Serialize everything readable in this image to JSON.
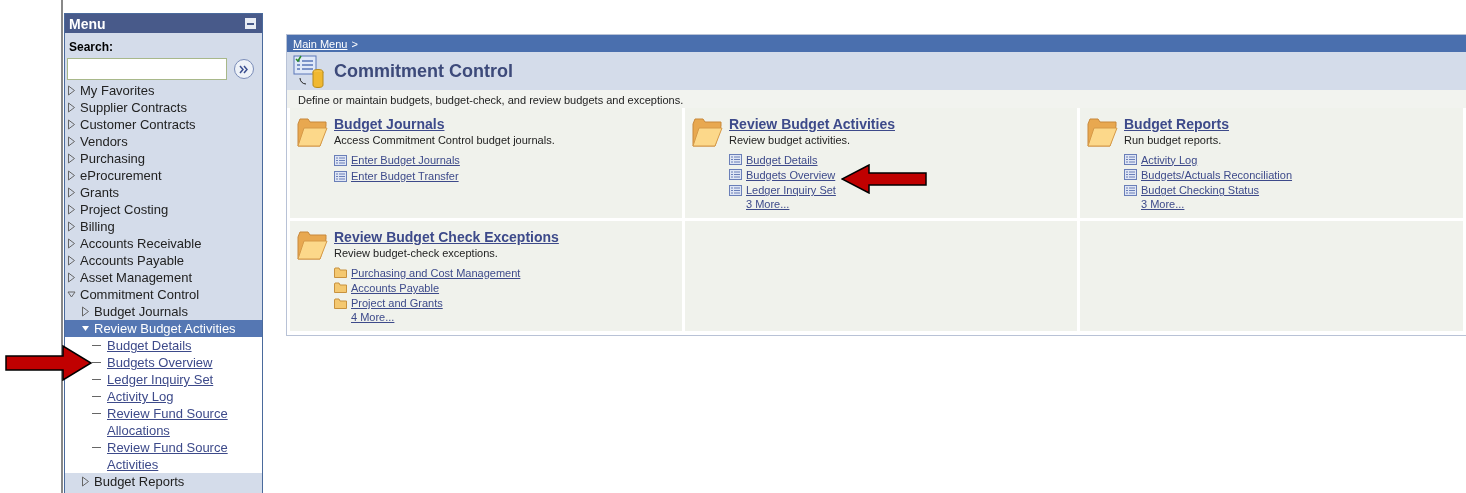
{
  "menu": {
    "title": "Menu",
    "search": {
      "label": "Search:"
    },
    "items": [
      {
        "label": "My Favorites",
        "kind": "folder",
        "expanded": false,
        "selected": false
      },
      {
        "label": "Supplier Contracts",
        "kind": "folder",
        "expanded": false,
        "selected": false
      },
      {
        "label": "Customer Contracts",
        "kind": "folder",
        "expanded": false,
        "selected": false
      },
      {
        "label": "Vendors",
        "kind": "folder",
        "expanded": false,
        "selected": false
      },
      {
        "label": "Purchasing",
        "kind": "folder",
        "expanded": false,
        "selected": false
      },
      {
        "label": "eProcurement",
        "kind": "folder",
        "expanded": false,
        "selected": false
      },
      {
        "label": "Grants",
        "kind": "folder",
        "expanded": false,
        "selected": false
      },
      {
        "label": "Project Costing",
        "kind": "folder",
        "expanded": false,
        "selected": false
      },
      {
        "label": "Billing",
        "kind": "folder",
        "expanded": false,
        "selected": false
      },
      {
        "label": "Accounts Receivable",
        "kind": "folder",
        "expanded": false,
        "selected": false
      },
      {
        "label": "Accounts Payable",
        "kind": "folder",
        "expanded": false,
        "selected": false
      },
      {
        "label": "Asset Management",
        "kind": "folder",
        "expanded": false,
        "selected": false
      },
      {
        "label": "Commitment Control",
        "kind": "folder",
        "expanded": true,
        "selected": false,
        "children": [
          {
            "label": "Budget Journals",
            "kind": "folder",
            "expanded": false,
            "selected": false
          },
          {
            "label": "Review Budget Activities",
            "kind": "folder",
            "expanded": true,
            "selected": true,
            "children": [
              {
                "label": "Budget Details",
                "kind": "link",
                "selected": false
              },
              {
                "label": "Budgets Overview",
                "kind": "link",
                "selected": false
              },
              {
                "label": "Ledger Inquiry Set",
                "kind": "link",
                "selected": false
              },
              {
                "label": "Activity Log",
                "kind": "link",
                "selected": false
              },
              {
                "label": "Review Fund Source Allocations",
                "kind": "link",
                "selected": false
              },
              {
                "label": "Review Fund Source Activities",
                "kind": "link",
                "selected": false
              }
            ]
          },
          {
            "label": "Budget Reports",
            "kind": "folder",
            "expanded": false,
            "selected": false
          }
        ]
      }
    ]
  },
  "content": {
    "breadcrumb": {
      "link": "Main Menu",
      "separator": ">"
    },
    "title": "Commitment Control",
    "description": "Define or maintain budgets, budget-check, and review budgets and exceptions.",
    "groups": [
      {
        "title": "Budget Journals",
        "description": "Access Commitment Control budget journals.",
        "links": [
          {
            "label": "Enter Budget Journals",
            "kind": "page"
          },
          {
            "label": "Enter Budget Transfer",
            "kind": "page"
          }
        ]
      },
      {
        "title": "Review Budget Activities",
        "description": "Review budget activities.",
        "links": [
          {
            "label": "Budget Details",
            "kind": "page"
          },
          {
            "label": "Budgets Overview",
            "kind": "page"
          },
          {
            "label": "Ledger Inquiry Set",
            "kind": "page"
          }
        ],
        "more": "3 More..."
      },
      {
        "title": "Budget Reports",
        "description": "Run budget reports.",
        "links": [
          {
            "label": "Activity Log",
            "kind": "page"
          },
          {
            "label": "Budgets/Actuals Reconciliation",
            "kind": "page"
          },
          {
            "label": "Budget Checking Status",
            "kind": "page"
          }
        ],
        "more": "3 More..."
      },
      {
        "title": "Review Budget Check Exceptions",
        "description": "Review budget-check exceptions.",
        "links": [
          {
            "label": "Purchasing and Cost Management",
            "kind": "folder"
          },
          {
            "label": "Accounts Payable",
            "kind": "folder"
          },
          {
            "label": "Project and Grants",
            "kind": "folder"
          }
        ],
        "more": "4 More..."
      }
    ]
  }
}
